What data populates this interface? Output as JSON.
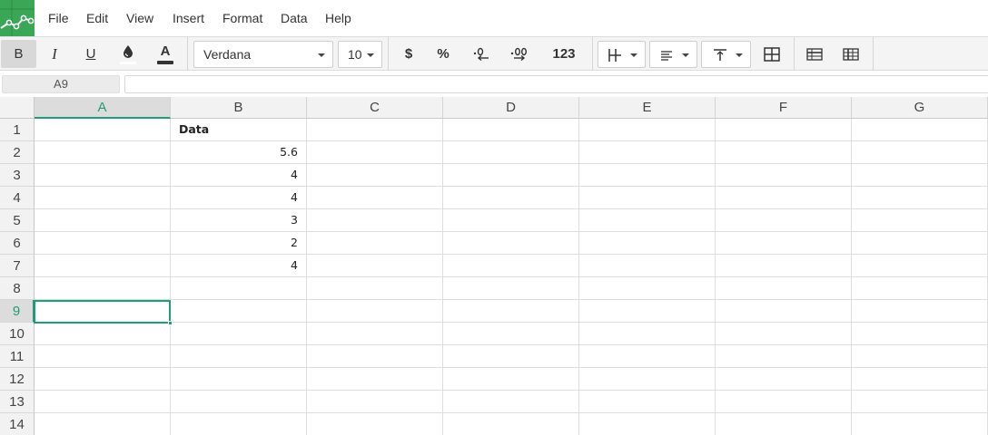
{
  "menu": [
    "File",
    "Edit",
    "View",
    "Insert",
    "Format",
    "Data",
    "Help"
  ],
  "toolbar": {
    "bold": "B",
    "italic": "I",
    "underline": "U",
    "text_color_glyph": "A",
    "font_family": "Verdana",
    "font_size": "10",
    "currency": "$",
    "percent": "%",
    "number_format": "123",
    "icons": [
      "bold-icon",
      "italic-icon",
      "underline-icon",
      "fill-color-icon",
      "text-color-icon",
      "currency-icon",
      "percent-icon",
      "decrease-decimals-icon",
      "increase-decimals-icon",
      "borders-icon",
      "align-left-icon",
      "vertical-align-top-icon",
      "merge-cells-icon",
      "freeze-rows-icon",
      "freeze-cols-icon"
    ],
    "colors": {
      "fill_color": "#ffffff",
      "text_color": "#333333"
    }
  },
  "formula_bar": {
    "cell_ref": "A9",
    "value": ""
  },
  "grid": {
    "columns": [
      "A",
      "B",
      "C",
      "D",
      "E",
      "F",
      "G"
    ],
    "rows": [
      "1",
      "2",
      "3",
      "4",
      "5",
      "6",
      "7",
      "8",
      "9",
      "10",
      "11",
      "12",
      "13",
      "14"
    ],
    "cells": {
      "B1": "Data",
      "B2": "5.6",
      "B3": "4",
      "B4": "4",
      "B5": "3",
      "B6": "2",
      "B7": "4"
    },
    "selected_cell": "A9",
    "accent_color": "#1e9e78"
  },
  "brand_color": "#3aa757"
}
